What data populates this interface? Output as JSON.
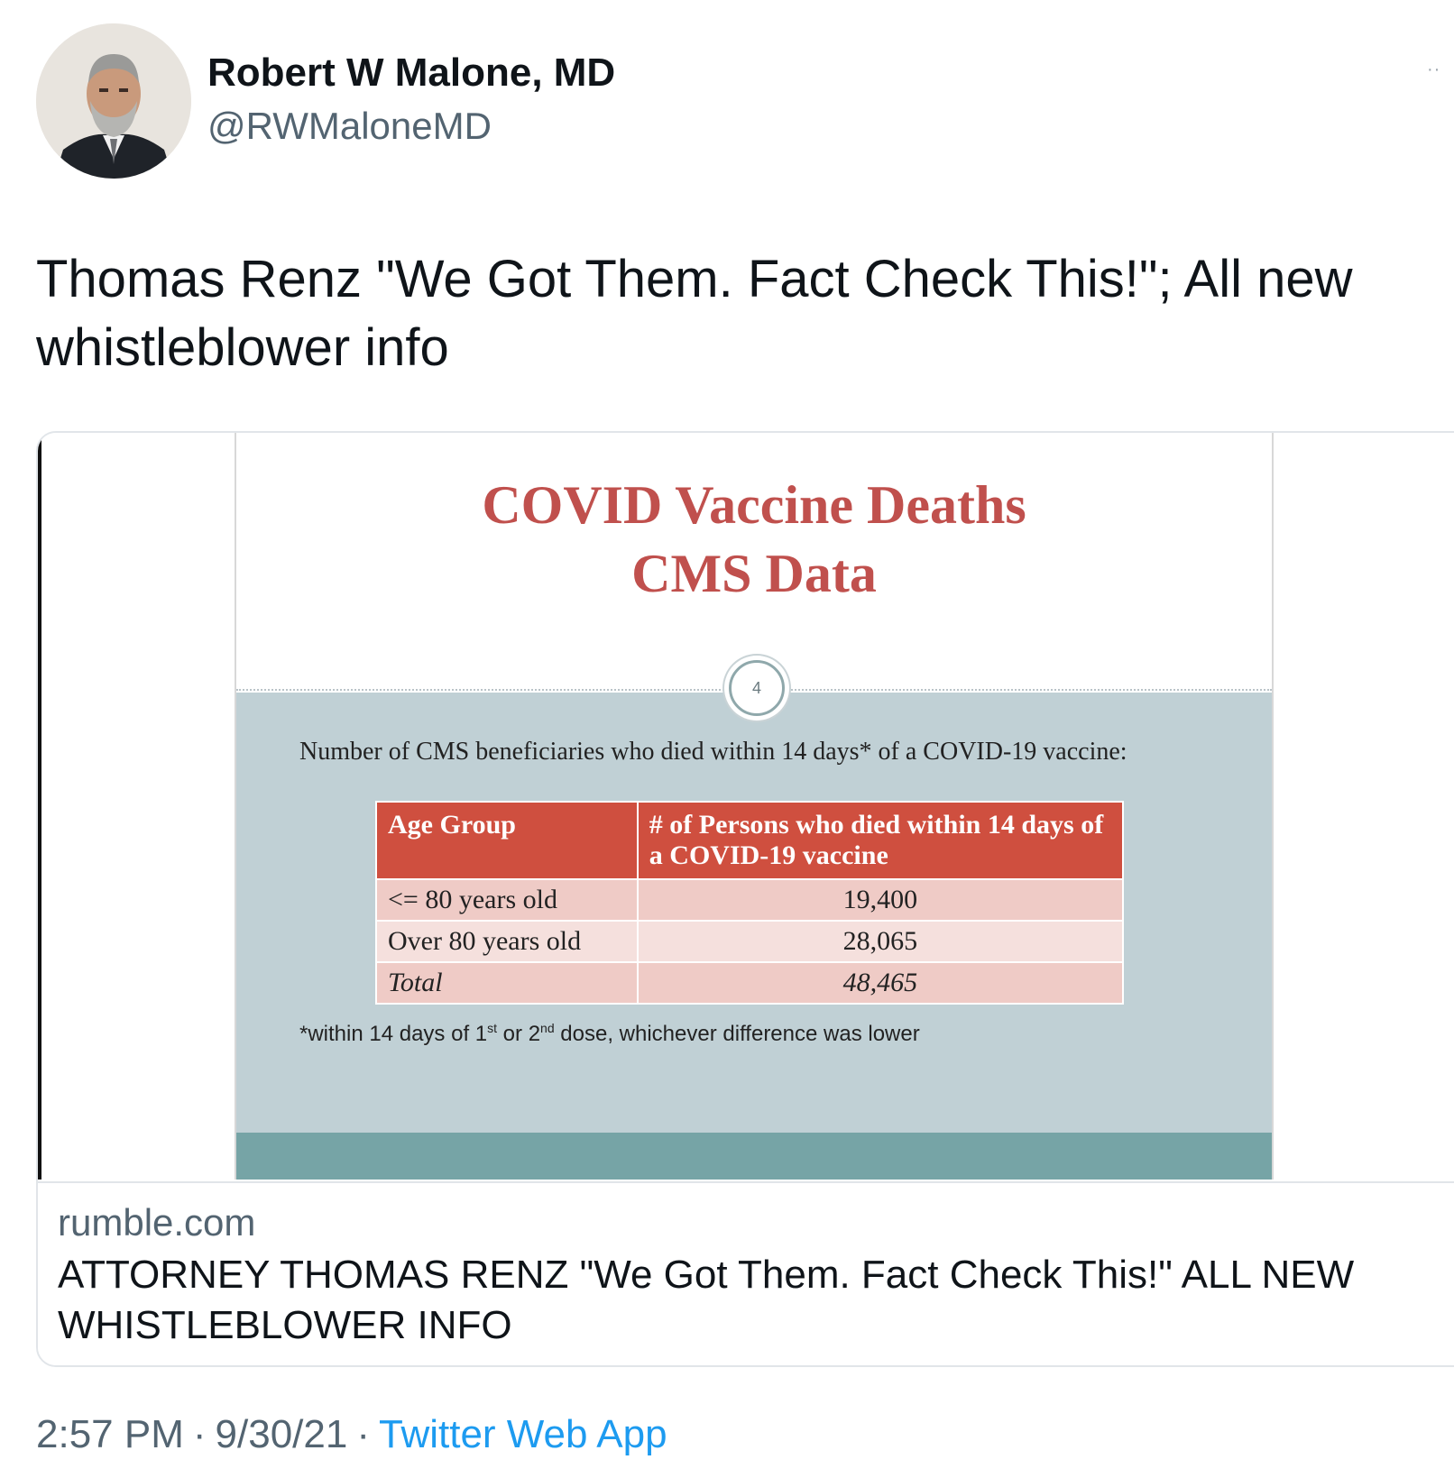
{
  "author": {
    "display_name": "Robert W Malone, MD",
    "handle": "@RWMaloneMD"
  },
  "more_label": "··",
  "tweet": {
    "text": "Thomas Renz \"We Got Them. Fact Check This!\";  All new whistleblower info"
  },
  "card": {
    "slide": {
      "title_line1": "COVID Vaccine Deaths",
      "title_line2": "CMS Data",
      "slide_number": "4",
      "caption": "Number of CMS beneficiaries who died within 14 days* of a COVID-19 vaccine:",
      "table": {
        "headers": [
          "Age Group",
          "# of Persons who died within 14 days of a COVID-19 vaccine"
        ],
        "rows": [
          [
            "<= 80 years old",
            "19,400"
          ],
          [
            "Over 80 years old",
            "28,065"
          ],
          [
            "Total",
            "48,465"
          ]
        ]
      },
      "footnote": {
        "pre": "*within 14 days of 1",
        "sup1": "st",
        "mid": " or 2",
        "sup2": "nd",
        "post": " dose, whichever difference was lower"
      }
    },
    "domain": "rumble.com",
    "title": "ATTORNEY THOMAS RENZ \"We Got Them. Fact Check This!\" ALL NEW WHISTLEBLOWER INFO"
  },
  "meta": {
    "time": "2:57 PM",
    "separator": "·",
    "date": "9/30/21",
    "source": "Twitter Web App"
  },
  "colors": {
    "slide_title": "#c0504d",
    "table_header": "#cf4f3f",
    "slide_background": "#c0d0d5",
    "link": "#1d9bf0"
  }
}
